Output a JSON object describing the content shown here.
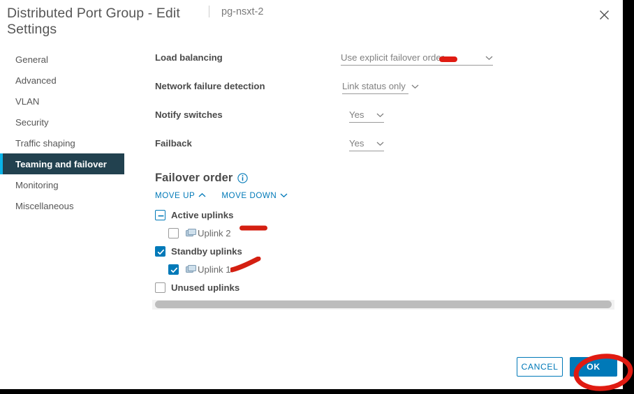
{
  "header": {
    "title": "Distributed Port Group - Edit Settings",
    "subtitle": "pg-nsxt-2",
    "close_icon": "close-icon"
  },
  "sidebar": {
    "items": [
      {
        "label": "General",
        "selected": false
      },
      {
        "label": "Advanced",
        "selected": false
      },
      {
        "label": "VLAN",
        "selected": false
      },
      {
        "label": "Security",
        "selected": false
      },
      {
        "label": "Traffic shaping",
        "selected": false
      },
      {
        "label": "Teaming and failover",
        "selected": true
      },
      {
        "label": "Monitoring",
        "selected": false
      },
      {
        "label": "Miscellaneous",
        "selected": false
      }
    ]
  },
  "form": {
    "rows": [
      {
        "label": "Load balancing",
        "value": "Use explicit failover order"
      },
      {
        "label": "Network failure detection",
        "value": "Link status only"
      },
      {
        "label": "Notify switches",
        "value": "Yes"
      },
      {
        "label": "Failback",
        "value": "Yes"
      }
    ]
  },
  "failover_order": {
    "heading": "Failover order",
    "info_icon": "info-icon",
    "move_up": "MOVE UP",
    "move_down": "MOVE DOWN",
    "tree": [
      {
        "label": "Active uplinks",
        "state": "indeterminate",
        "child": false,
        "icon": null
      },
      {
        "label": "Uplink 2",
        "state": "unchecked",
        "child": true,
        "icon": "nic-icon"
      },
      {
        "label": "Standby uplinks",
        "state": "checked",
        "child": false,
        "icon": null
      },
      {
        "label": "Uplink 1",
        "state": "checked",
        "child": true,
        "icon": "nic-icon"
      },
      {
        "label": "Unused uplinks",
        "state": "unchecked",
        "child": false,
        "icon": null
      }
    ]
  },
  "footer": {
    "cancel_label": "CANCEL",
    "ok_label": "OK"
  },
  "colors": {
    "accent": "#0079b8",
    "sidebar_selected_bg": "#22414f",
    "sidebar_selected_bar": "#0ab3e8",
    "annotation_red": "#e01b12",
    "scrollbar_thumb": "#bcbcbc"
  }
}
